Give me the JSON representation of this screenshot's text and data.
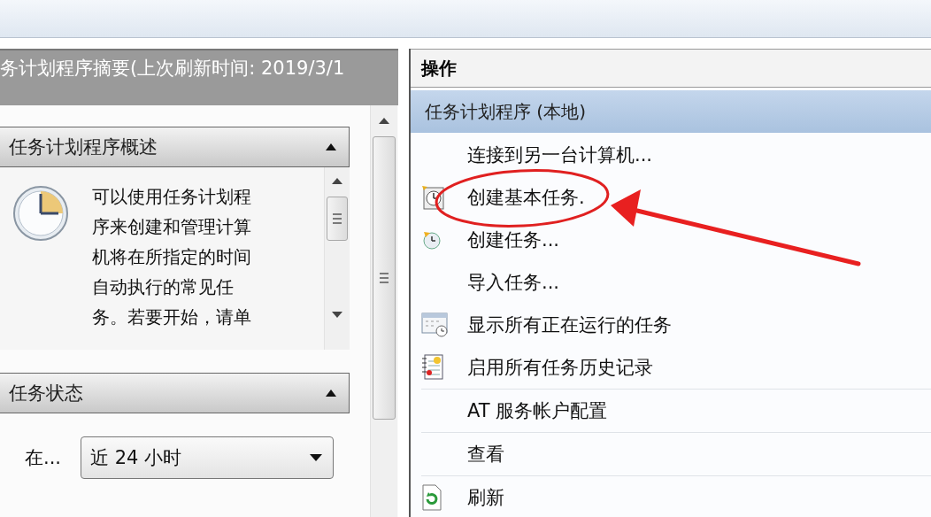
{
  "summary_header": {
    "title": "务计划程序摘要(上次刷新时间: 2019/3/1"
  },
  "sections": [
    {
      "title": "任务计划程序概述",
      "expanded": true,
      "description": [
        "可以使用任务计划程",
        "序来创建和管理计算",
        "机将在所指定的时间",
        "自动执行的常见任",
        "务。若要开始，请单"
      ]
    },
    {
      "title": "任务状态",
      "expanded": true,
      "filter_label": "在...",
      "filter_value": "近 24 小时"
    }
  ],
  "actions": {
    "title": "操作",
    "group": {
      "title": "任务计划程序 (本地)",
      "selected": true
    },
    "item_groups": [
      {
        "items": [
          {
            "label": "连接到另一台计算机...",
            "kind": "plain"
          },
          {
            "label": "创建基本任务.",
            "kind": "basic-task"
          },
          {
            "label": "创建任务...",
            "kind": "task"
          },
          {
            "label": "导入任务...",
            "kind": "plain"
          },
          {
            "label": "显示所有正在运行的任务",
            "kind": "running"
          },
          {
            "label": "启用所有任务历史记录",
            "kind": "history"
          }
        ]
      },
      {
        "items": [
          {
            "label": "AT 服务帐户配置",
            "kind": "plain"
          }
        ]
      },
      {
        "items": [
          {
            "label": "查看",
            "kind": "plain"
          }
        ]
      },
      {
        "items": [
          {
            "label": "刷新",
            "kind": "refresh"
          }
        ]
      }
    ]
  }
}
